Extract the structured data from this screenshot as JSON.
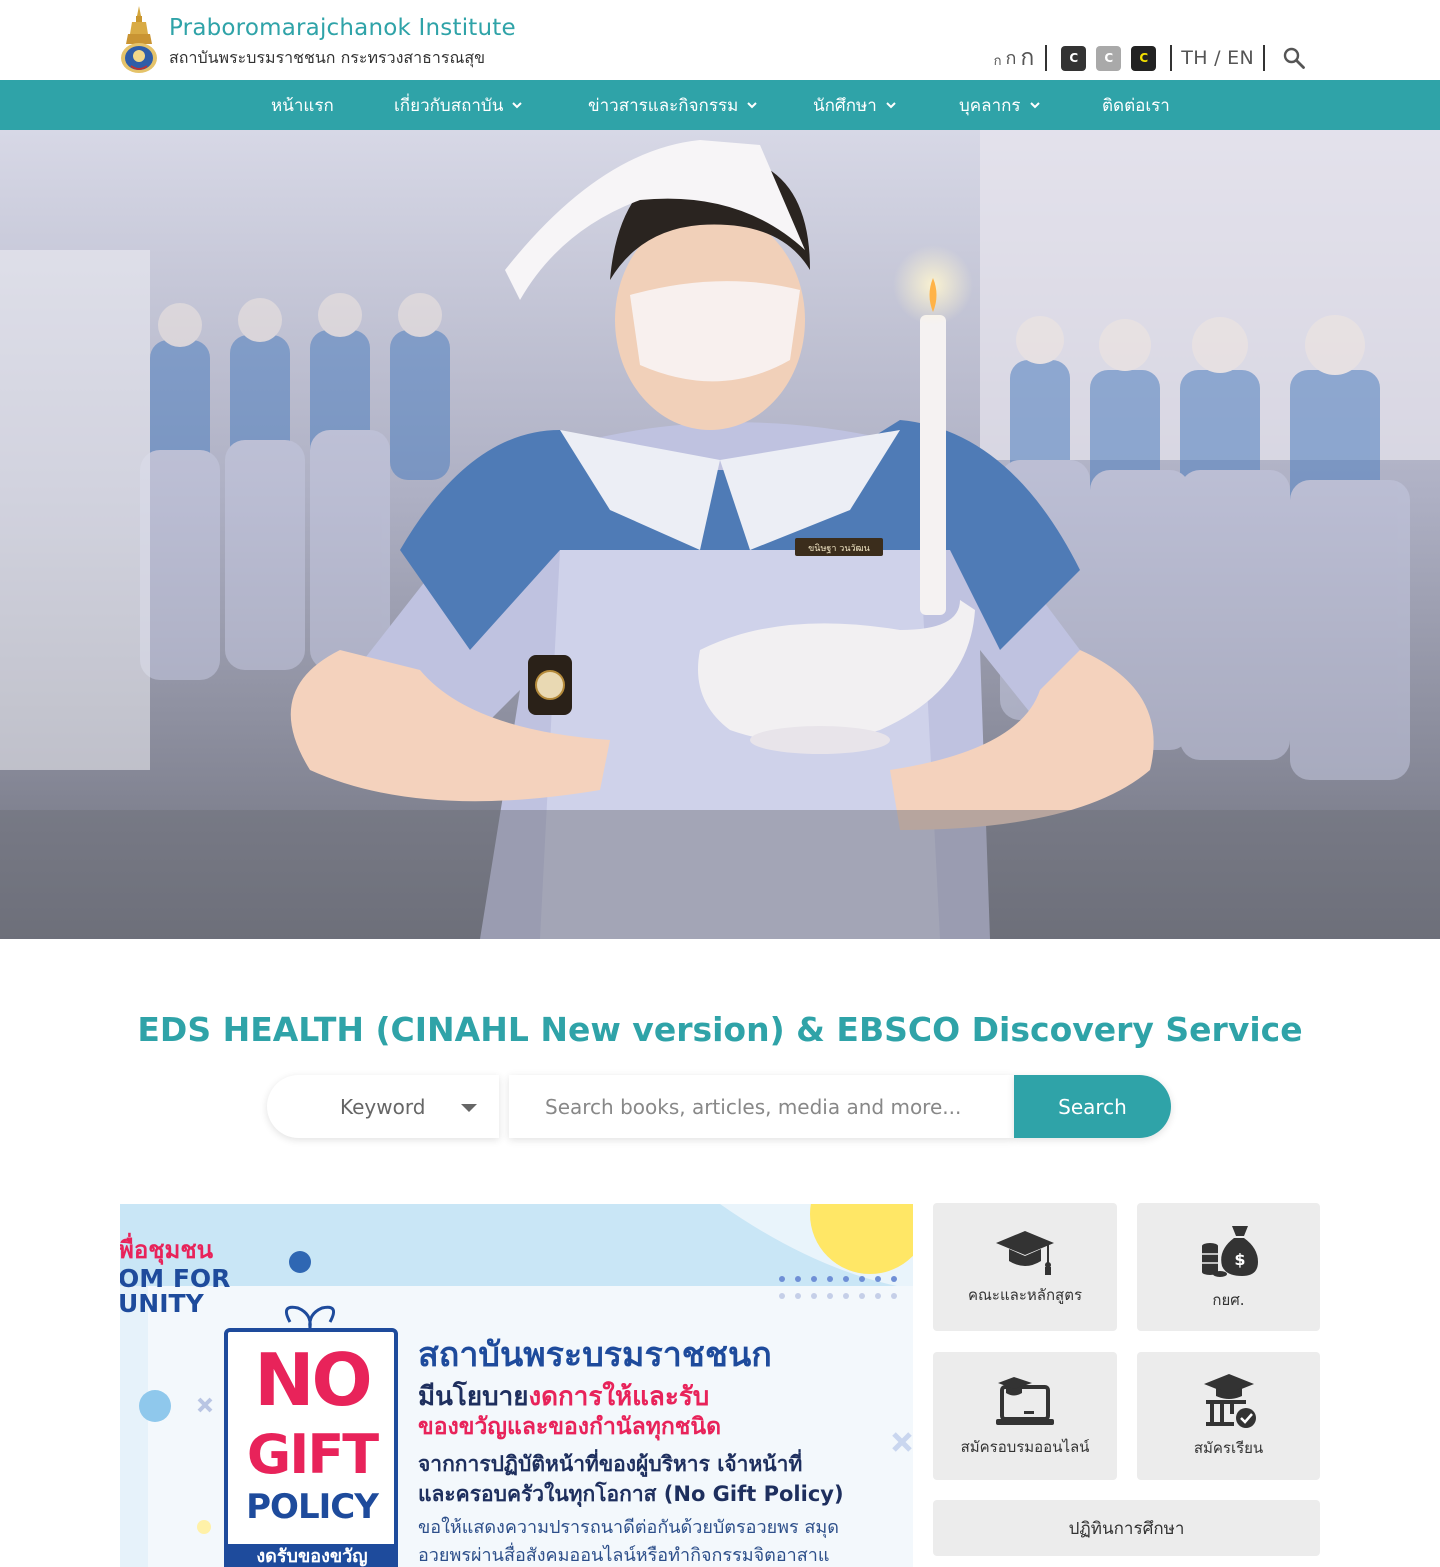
{
  "header": {
    "brand_en": "Praboromarajchanok Institute",
    "brand_th": "สถาบันพระบรมราชชนก กระทรวงสาธารณสุข",
    "font_sizes": [
      "ก",
      "ก",
      "ก"
    ],
    "contrast_buttons": [
      "C",
      "C",
      "C"
    ],
    "language": "TH / EN"
  },
  "nav": {
    "items": [
      {
        "label": "หน้าแรก",
        "dropdown": false
      },
      {
        "label": "เกี่ยวกับสถาบัน",
        "dropdown": true
      },
      {
        "label": "ข่าวสารและกิจกรรม",
        "dropdown": true
      },
      {
        "label": "นักศึกษา",
        "dropdown": true
      },
      {
        "label": "บุคลากร",
        "dropdown": true
      },
      {
        "label": "ติดต่อเรา",
        "dropdown": false
      }
    ]
  },
  "hero": {
    "badge_text": "ขนิษฐา วนวัฒน"
  },
  "eds": {
    "title": "EDS HEALTH (CINAHL New version) & EBSCO Discovery Service",
    "select_value": "Keyword",
    "placeholder": "Search books, articles, media and more...",
    "button": "Search"
  },
  "banner": {
    "left_top": "พื่อชุมชน",
    "left_mid1": "OM FOR",
    "left_mid2": "UNITY",
    "policy_no": "NO",
    "policy_gift": "GIFT",
    "policy_policy": "POLICY",
    "policy_bottom": "งดรับของขวัญ",
    "headline": "สถาบันพระบรมราชชนก",
    "line2_a": "มีนโยบาย",
    "line2_b": "งดการให้และรับ",
    "line3": "ของขวัญและของกำนัลทุกชนิด",
    "line4": "จากการปฏิบัติหน้าที่ของผู้บริหาร เจ้าหน้าที่",
    "line5": "และครอบครัวในทุกโอกาส (No Gift Policy)",
    "line6": "ขอให้แสดงความปรารถนาดีต่อกันด้วยบัตรอวยพร สมุด",
    "line7": "อวยพรผ่านสื่อสังคมออนไลน์หรือทำกิจกรรมจิตอาสาแ"
  },
  "tiles": [
    {
      "label": "คณะและหลักสูตร",
      "icon": "graduation-cap-icon"
    },
    {
      "label": "กยศ.",
      "icon": "money-bag-icon"
    },
    {
      "label": "สมัครอบรมออนไลน์",
      "icon": "online-training-icon"
    },
    {
      "label": "สมัครเรียน",
      "icon": "enroll-icon"
    }
  ],
  "calendar_button": "ปฏิทินการศึกษา",
  "colors": {
    "primary": "#2fa3a8",
    "nav_text": "#ffffff",
    "tile_bg": "#ececec",
    "banner_red": "#e8235a",
    "banner_blue": "#1e4b9c"
  }
}
